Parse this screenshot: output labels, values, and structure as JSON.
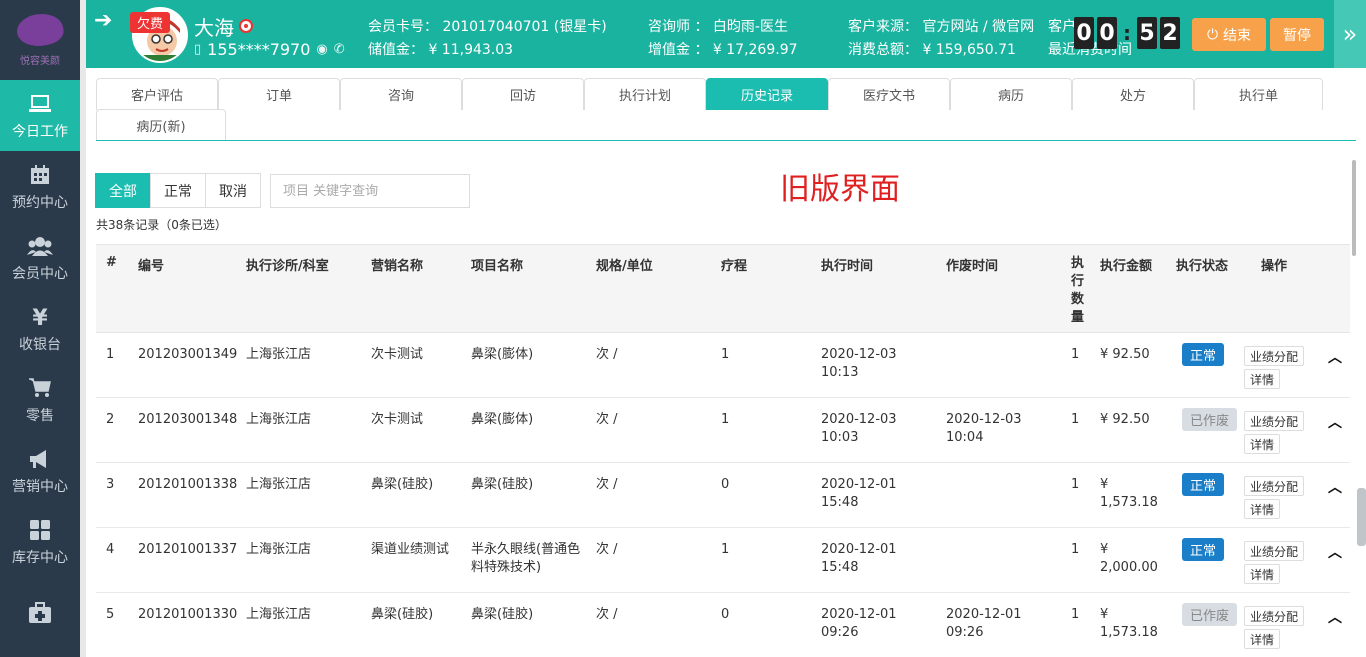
{
  "colors": {
    "primary": "#1ab3a0",
    "accent": "#1bbdb1",
    "sidebar": "#2b3a4a",
    "warn": "#f7a24a",
    "danger": "#e33",
    "old_label": "#e02020"
  },
  "sidebar": {
    "logo_text": "悦容美颜",
    "items": [
      {
        "label": "今日工作",
        "icon": "laptop-icon"
      },
      {
        "label": "预约中心",
        "icon": "calendar-icon"
      },
      {
        "label": "会员中心",
        "icon": "users-icon"
      },
      {
        "label": "收银台",
        "icon": "yen-icon"
      },
      {
        "label": "零售",
        "icon": "cart-icon"
      },
      {
        "label": "营销中心",
        "icon": "megaphone-icon"
      },
      {
        "label": "库存中心",
        "icon": "grid-icon"
      },
      {
        "label": "",
        "icon": "medkit-icon"
      }
    ]
  },
  "header": {
    "arrear_badge": "欠费",
    "name": "大海",
    "phone": "155****7970",
    "card_no": "会员卡号： 201017040701 (银星卡)",
    "stored": "储值金： ¥ 11,943.03",
    "consultant": "咨询师 ： 白昀雨-医生",
    "bonus": "增值金 ： ¥ 17,269.97",
    "source": "客户来源： 官方网站 / 微官网",
    "total": "消费总额： ¥ 159,650.71",
    "cust_partial": "客户",
    "last_partial": "最近消费时间",
    "timer": [
      "0",
      "0",
      "5",
      "2"
    ],
    "end_label": "结束",
    "pause_label": "暂停"
  },
  "tabs": [
    "客户评估",
    "订单",
    "咨询",
    "回访",
    "执行计划",
    "历史记录",
    "医疗文书",
    "病历",
    "处方",
    "执行单",
    "病历(新)"
  ],
  "active_tab": "历史记录",
  "filters": [
    "全部",
    "正常",
    "取消"
  ],
  "search_placeholder": "项目 关键字查询",
  "old_ui_label": "旧版界面",
  "record_count": "共38条记录（0条已选）",
  "table": {
    "headers": [
      "#",
      "编号",
      "执行诊所/科室",
      "营销名称",
      "项目名称",
      "规格/单位",
      "疗程",
      "执行时间",
      "作废时间",
      "执行数量",
      "执行金额",
      "执行状态",
      "操作"
    ],
    "rows": [
      {
        "idx": "1",
        "code": "201203001349",
        "clinic": "上海张江店",
        "marketing": "次卡测试",
        "item": "鼻梁(膨体)",
        "unit": "次 /",
        "course": "1",
        "exec_time": "2020-12-03 10:13",
        "void_time": "",
        "qty": "1",
        "amount": "¥ 92.50",
        "status": "正常",
        "status_type": "normal",
        "op1": "业绩分配",
        "op2": "详情"
      },
      {
        "idx": "2",
        "code": "201203001348",
        "clinic": "上海张江店",
        "marketing": "次卡测试",
        "item": "鼻梁(膨体)",
        "unit": "次 /",
        "course": "1",
        "exec_time": "2020-12-03 10:03",
        "void_time": "2020-12-03 10:04",
        "qty": "1",
        "amount": "¥ 92.50",
        "status": "已作废",
        "status_type": "void",
        "op1": "业绩分配",
        "op2": "详情"
      },
      {
        "idx": "3",
        "code": "201201001338",
        "clinic": "上海张江店",
        "marketing": "鼻梁(硅胶)",
        "item": "鼻梁(硅胶)",
        "unit": "次 /",
        "course": "0",
        "exec_time": "2020-12-01 15:48",
        "void_time": "",
        "qty": "1",
        "amount": "¥ 1,573.18",
        "status": "正常",
        "status_type": "normal",
        "op1": "业绩分配",
        "op2": "详情"
      },
      {
        "idx": "4",
        "code": "201201001337",
        "clinic": "上海张江店",
        "marketing": "渠道业绩测试",
        "item": "半永久眼线(普通色料特殊技术)",
        "unit": "次 /",
        "course": "1",
        "exec_time": "2020-12-01 15:48",
        "void_time": "",
        "qty": "1",
        "amount": "¥ 2,000.00",
        "status": "正常",
        "status_type": "normal",
        "op1": "业绩分配",
        "op2": "详情"
      },
      {
        "idx": "5",
        "code": "201201001330",
        "clinic": "上海张江店",
        "marketing": "鼻梁(硅胶)",
        "item": "鼻梁(硅胶)",
        "unit": "次 /",
        "course": "0",
        "exec_time": "2020-12-01 09:26",
        "void_time": "2020-12-01 09:26",
        "qty": "1",
        "amount": "¥ 1,573.18",
        "status": "已作废",
        "status_type": "void",
        "op1": "业绩分配",
        "op2": "详情"
      }
    ]
  }
}
